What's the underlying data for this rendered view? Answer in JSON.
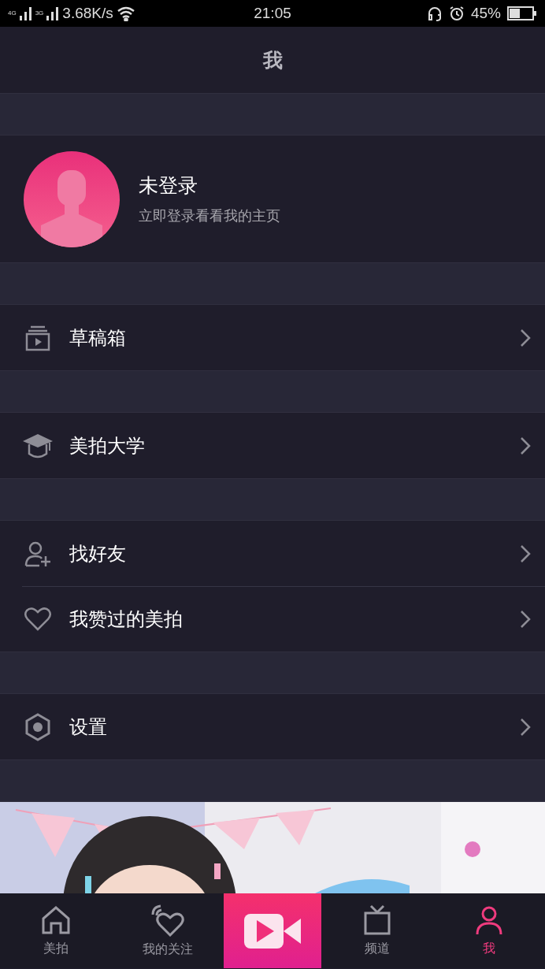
{
  "status_bar": {
    "network_1": "4G",
    "network_2": "3G",
    "speed": "3.68K/s",
    "time": "21:05",
    "battery": "45%"
  },
  "header": {
    "title": "我"
  },
  "profile": {
    "name": "未登录",
    "hint": "立即登录看看我的主页"
  },
  "menu_groups": [
    {
      "items": [
        {
          "kind": "drafts",
          "label": "草稿箱"
        }
      ]
    },
    {
      "items": [
        {
          "kind": "school",
          "label": "美拍大学"
        }
      ]
    },
    {
      "items": [
        {
          "kind": "friends",
          "label": "找好友"
        },
        {
          "kind": "likes",
          "label": "我赞过的美拍"
        }
      ]
    },
    {
      "items": [
        {
          "kind": "settings",
          "label": "设置"
        }
      ]
    }
  ],
  "tab_bar": [
    {
      "kind": "home",
      "label": "美拍",
      "selected": false
    },
    {
      "kind": "follow",
      "label": "我的关注",
      "selected": false
    },
    {
      "kind": "record"
    },
    {
      "kind": "channel",
      "label": "频道",
      "selected": false
    },
    {
      "kind": "me",
      "label": "我",
      "selected": true
    }
  ]
}
